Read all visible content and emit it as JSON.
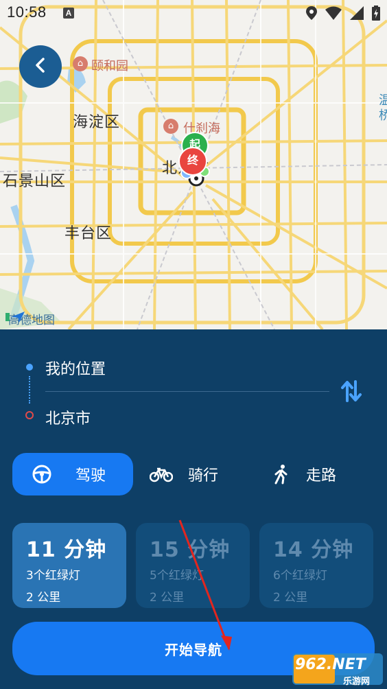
{
  "status_bar": {
    "time": "10:58",
    "notif_letter": "A"
  },
  "map": {
    "districts": [
      "海淀区",
      "石景山区",
      "丰台区",
      "北京市"
    ],
    "pois": [
      "颐和园",
      "什刹海"
    ],
    "marker_start": "起",
    "marker_end": "终",
    "logo_text": "高德地图",
    "edge_label_right": "温\n桥"
  },
  "route": {
    "origin": "我的位置",
    "destination": "北京市"
  },
  "modes": [
    {
      "label": "驾驶",
      "icon": "steering-wheel-icon"
    },
    {
      "label": "骑行",
      "icon": "bicycle-icon"
    },
    {
      "label": "走路",
      "icon": "walking-icon"
    }
  ],
  "options": [
    {
      "time": "11 分钟",
      "lights": "3个红绿灯",
      "distance": "2 公里"
    },
    {
      "time": "15 分钟",
      "lights": "5个红绿灯",
      "distance": "2 公里"
    },
    {
      "time": "14 分钟",
      "lights": "6个红绿灯",
      "distance": "2 公里"
    }
  ],
  "start_button": "开始导航",
  "watermark": {
    "brand": "962.NET",
    "sub": "乐游网"
  },
  "colors": {
    "accent": "#1779f2",
    "panel": "#0e3f66",
    "card_active": "#2a74b4",
    "card_inactive": "#124d7a"
  }
}
